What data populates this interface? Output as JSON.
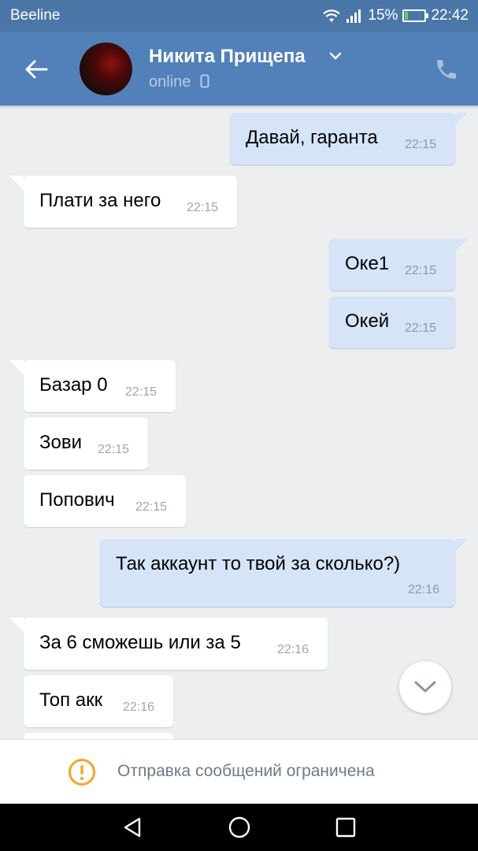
{
  "status_bar": {
    "carrier": "Beeline",
    "battery_percent": "15%",
    "battery_level": 0.15,
    "time": "22:42",
    "icons": [
      "wifi-icon",
      "signal-icon",
      "battery-charging-icon"
    ]
  },
  "header": {
    "contact_name": "Никита Прищепа",
    "presence": "online",
    "icons": [
      "back-arrow-icon",
      "chevron-down-icon",
      "mobile-device-icon",
      "phone-icon"
    ]
  },
  "messages": [
    {
      "direction": "out",
      "text": "Давай, гаранта",
      "time": "22:15"
    },
    {
      "direction": "in",
      "text": "Плати за него",
      "time": "22:15"
    },
    {
      "direction": "out",
      "text": "Оке1",
      "time": "22:15"
    },
    {
      "direction": "out",
      "text": "Окей",
      "time": "22:15"
    },
    {
      "direction": "in",
      "text": "Базар 0",
      "time": "22:15"
    },
    {
      "direction": "in",
      "text": "Зови",
      "time": "22:15"
    },
    {
      "direction": "in",
      "text": "Попович",
      "time": "22:15"
    },
    {
      "direction": "out",
      "text": "Так аккаунт то твой за сколько?)",
      "time": "22:16"
    },
    {
      "direction": "in",
      "text": "За 6 сможешь или за 5",
      "time": "22:16"
    },
    {
      "direction": "in",
      "text": "Топ акк",
      "time": "22:16"
    }
  ],
  "restriction": {
    "text": "Отправка сообщений ограничена",
    "icon": "warning-icon"
  },
  "colors": {
    "header": "#5181b8",
    "status_bar": "#4a76a8",
    "outgoing_bubble": "#d5e4f6",
    "incoming_bubble": "#ffffff",
    "background": "#edeef0",
    "warning": "#f5a623"
  },
  "nav": [
    "back-triangle-icon",
    "home-circle-icon",
    "recents-square-icon"
  ]
}
